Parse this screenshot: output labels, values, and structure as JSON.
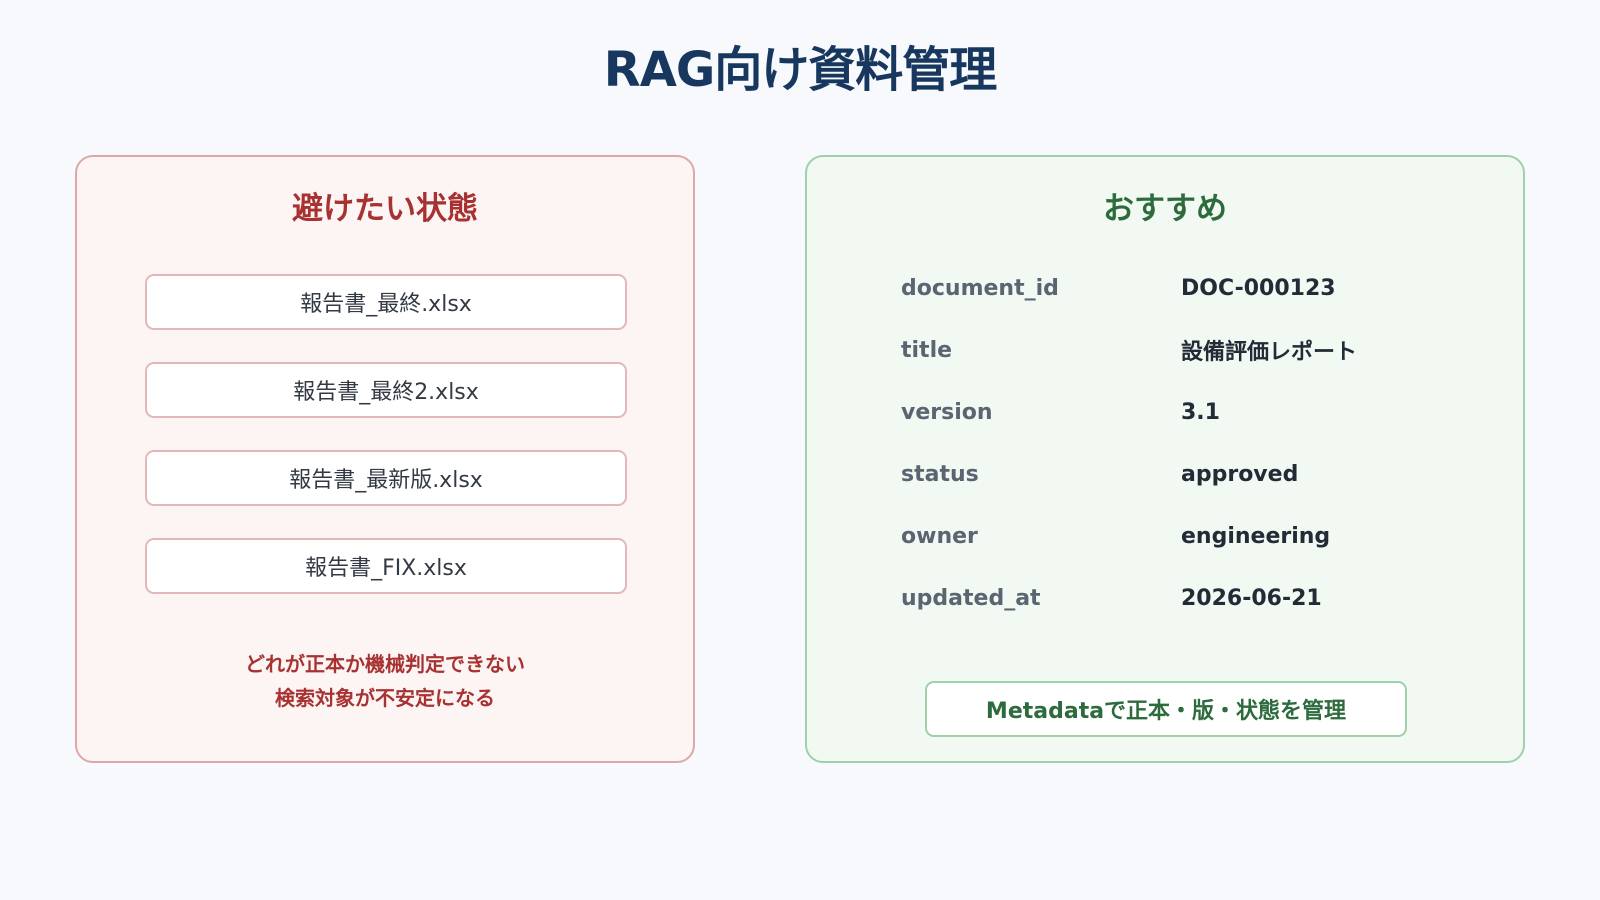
{
  "page": {
    "title": "RAG向け資料管理"
  },
  "bad_panel": {
    "title": "避けたい状態",
    "files": [
      "報告書_最終.xlsx",
      "報告書_最終2.xlsx",
      "報告書_最新版.xlsx",
      "報告書_FIX.xlsx"
    ],
    "note_lines": [
      "どれが正本か機械判定できない",
      "検索対象が不安定になる"
    ]
  },
  "good_panel": {
    "title": "おすすめ",
    "metadata": [
      {
        "key": "document_id",
        "value": "DOC-000123"
      },
      {
        "key": "title",
        "value": "設備評価レポート"
      },
      {
        "key": "version",
        "value": "3.1"
      },
      {
        "key": "status",
        "value": "approved"
      },
      {
        "key": "owner",
        "value": "engineering"
      },
      {
        "key": "updated_at",
        "value": "2026-06-21"
      }
    ],
    "summary": "Metadataで正本・版・状態を管理"
  },
  "colors": {
    "title": "#17375e",
    "bad_accent": "#a83232",
    "good_accent": "#2d6b3d",
    "bad_bg": "#fdf4f4",
    "good_bg": "#f1f9f2"
  }
}
